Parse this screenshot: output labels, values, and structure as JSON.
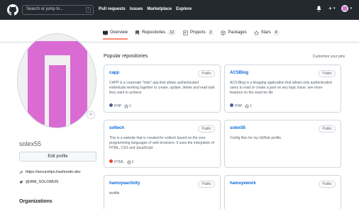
{
  "header": {
    "search_placeholder": "Search or jump to...",
    "search_shortcut": "/",
    "nav": [
      "Pull requests",
      "Issues",
      "Marketplace",
      "Explore"
    ],
    "plus": "+",
    "caret": "▾"
  },
  "tabs": [
    {
      "label": "Overview",
      "count": null
    },
    {
      "label": "Repositories",
      "count": "12"
    },
    {
      "label": "Projects",
      "count": "2"
    },
    {
      "label": "Packages",
      "count": null
    },
    {
      "label": "Stars",
      "count": "4"
    }
  ],
  "profile": {
    "username": "solex55",
    "edit_button": "Edit profile",
    "website": "https://securetips.hashnode.dev",
    "twitter": "@IAM_SOLOMUN",
    "orgs_title": "Organizations",
    "emoji": "☺"
  },
  "popular": {
    "title": "Popular repositories",
    "customize": "Customize your pins",
    "repos": [
      {
        "name": "capp",
        "badge": "Public",
        "desc": "CAPP is a corporate \"todo\" app that allows authenticated individuals working together to create, update, delete and read task they want to achieve",
        "lang": "PHP",
        "lang_color": "#4F5D95",
        "stars": "1"
      },
      {
        "name": "ACSBlog",
        "badge": "Public",
        "desc": "ACS-Blog is a blogging application that allows only authenticated users to read or create a post on any topic issue. see more features on the read me file",
        "lang": "PHP",
        "lang_color": "#4F5D95",
        "stars": "1"
      },
      {
        "name": "soltech",
        "badge": "Public",
        "desc": "This is a website that is created for soltech based on the core programming languages of web browsers. It uses the integration of HTML, CSS and JavaScript",
        "lang": "HTML",
        "lang_color": "#e34c26",
        "stars": "1"
      },
      {
        "name": "solex55",
        "badge": "Public",
        "desc": "Config files for my GitHub profile.",
        "lang": "",
        "lang_color": "",
        "stars": ""
      },
      {
        "name": "hamoyeactivity",
        "badge": "Public",
        "desc": "testfile",
        "lang": "",
        "lang_color": "",
        "stars": ""
      },
      {
        "name": "hamoyework",
        "badge": "Public",
        "desc": "",
        "lang": "",
        "lang_color": "",
        "stars": ""
      }
    ]
  }
}
